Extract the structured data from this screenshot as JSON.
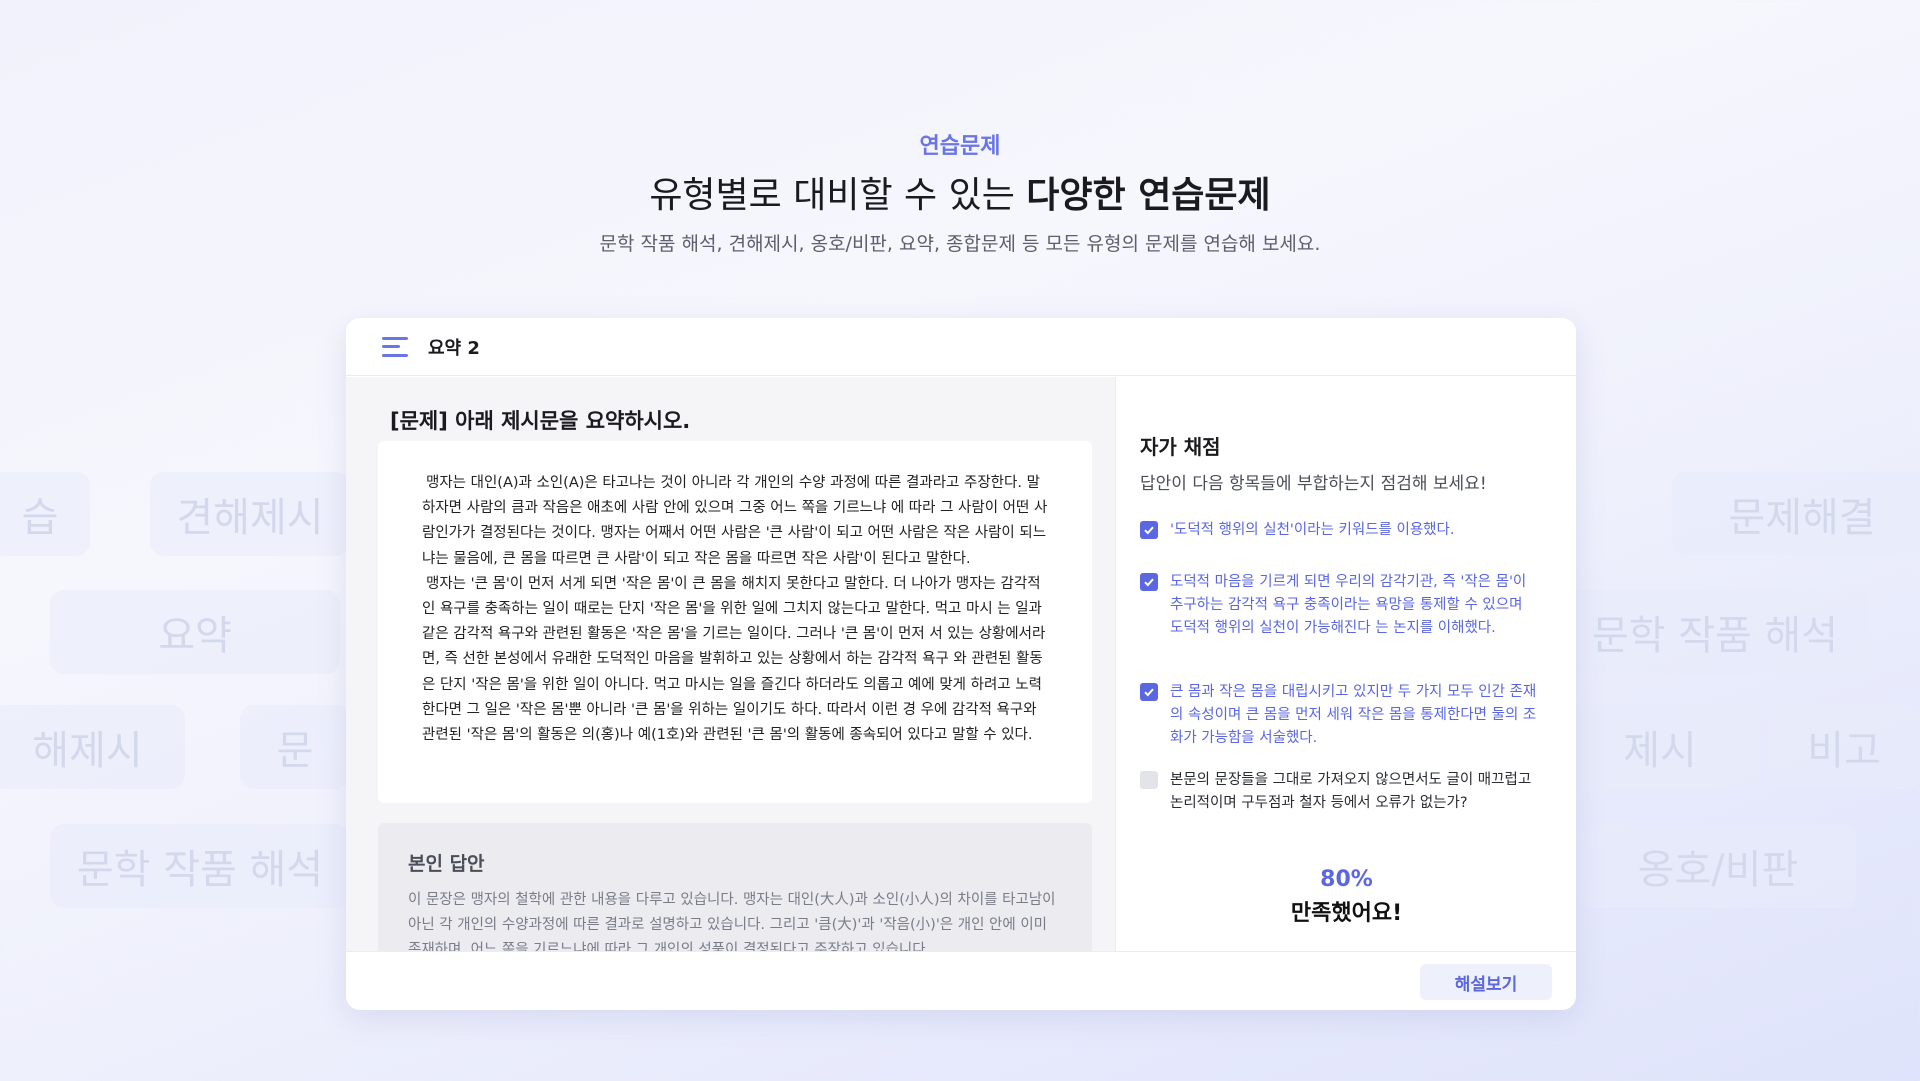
{
  "background_chips": [
    "습",
    "견해제시",
    "요약",
    "해제시",
    "문",
    "문학 작품 해석",
    "문제해결",
    "문학 작품 해석",
    "제시",
    "비고",
    "옹호/비판"
  ],
  "hero": {
    "eyebrow": "연습문제",
    "headline_regular": "유형별로 대비할 수 있는 ",
    "headline_strong": "다양한 연습문제",
    "subline": "문학 작품 해석, 견해제시, 옹호/비판, 요약, 종합문제 등 모든 유형의 문제를 연습해 보세요."
  },
  "window": {
    "title": "요약 2",
    "menu_icon": "hamburger-menu-icon"
  },
  "question": {
    "prompt": "[문제] 아래 제시문을 요약하시오.",
    "passage": [
      "맹자는 대인(A)과 소인(A)은 타고나는 것이 아니라 각 개인의 수양 과정에 따른 결과라고 주장한다. 말하자면 사람의 큼과 작음은 애초에 사람 안에 있으며 그중 어느 쪽을 기르느냐 에 따라 그 사람이 어떤 사람인가가 결정된다는 것이다. 맹자는 어째서 어떤 사람은 '큰 사람'이 되고 어떤 사람은 작은 사람이 되느냐는 물음에, 큰 몸을 따르면 큰 사람'이 되고 작은 몸을 따르면 작은 사람'이 된다고 말한다.",
      "맹자는 '큰 몸'이 먼저 서게 되면 '작은 몸'이 큰 몸을 해치지 못한다고 말한다. 더 나아가 맹자는 감각적인 욕구를 충족하는 일이 때로는 단지 '작은 몸'을 위한 일에 그치지 않는다고 말한다. 먹고 마시 는 일과 같은 감각적 욕구와 관련된 활동은 '작은 몸'을 기르는 일이다. 그러나 '큰 몸'이 먼저 서 있는 상황에서라면, 즉 선한 본성에서 유래한 도덕적인 마음을 발휘하고 있는 상황에서 하는 감각적 욕구 와 관련된 활동은 단지 '작은 몸'을 위한 일이 아니다. 먹고 마시는 일을 즐긴다 하더라도 의롭고 예에 맞게 하려고 노력한다면 그 일은 '작은 몸'뿐 아니라 '큰 몸'을 위하는 일이기도 하다. 따라서 이런 경 우에 감각적 욕구와 관련된 '작은 몸'의 활동은 의(홍)나 예(1호)와 관련된 '큰 몸'의 활동에 종속되어 있다고 말할 수 있다."
    ]
  },
  "answer": {
    "title": "본인 답안",
    "text": "이 문장은 맹자의 철학에 관한 내용을 다루고 있습니다. 맹자는 대인(大人)과 소인(小人)의 차이를 타고남이 아닌 각 개인의 수양과정에 따른 결과로 설명하고 있습니다. 그리고 '큼(大)'과 '작음(小)'은 개인 안에 이미 존재하며, 어느 쪽을 기르느냐에 따라 그 개인의 성품이 결정된다고 주장하고 있습니다."
  },
  "self_grade": {
    "title": "자가 채점",
    "subtitle": "답안이 다음 항목들에 부합하는지 점검해 보세요!",
    "items": [
      {
        "text": "'도덕적 행위의 실천'이라는 키워드를 이용했다.",
        "checked": true
      },
      {
        "text": "도덕적 마음을 기르게 되면 우리의 감각기관, 즉 '작은 몸'이 추구하는 감각적 욕구 충족이라는 욕망을 통제할 수 있으며 도덕적 행위의 실천이 가능해진다 는 논지를 이해했다.",
        "checked": true
      },
      {
        "text": "큰 몸과 작은 몸을 대립시키고 있지만 두 가지 모두 인간 존재의 속성이며 큰 몸을 먼저 세워 작은 몸을 통제한다면 둘의 조화가 가능함을 서술했다.",
        "checked": true
      },
      {
        "text": "본문의 문장들을 그대로 가져오지 않으면서도 글이 매끄럽고 논리적이며 구두점과 철자 등에서 오류가 없는가?",
        "checked": false
      }
    ],
    "score_percent": "80%",
    "score_message": "만족했어요!"
  },
  "footer": {
    "explain_label": "해설보기"
  },
  "colors": {
    "accent": "#5b67e0",
    "eyebrow": "#6a76e6",
    "unchecked": "#e3e4ea"
  }
}
